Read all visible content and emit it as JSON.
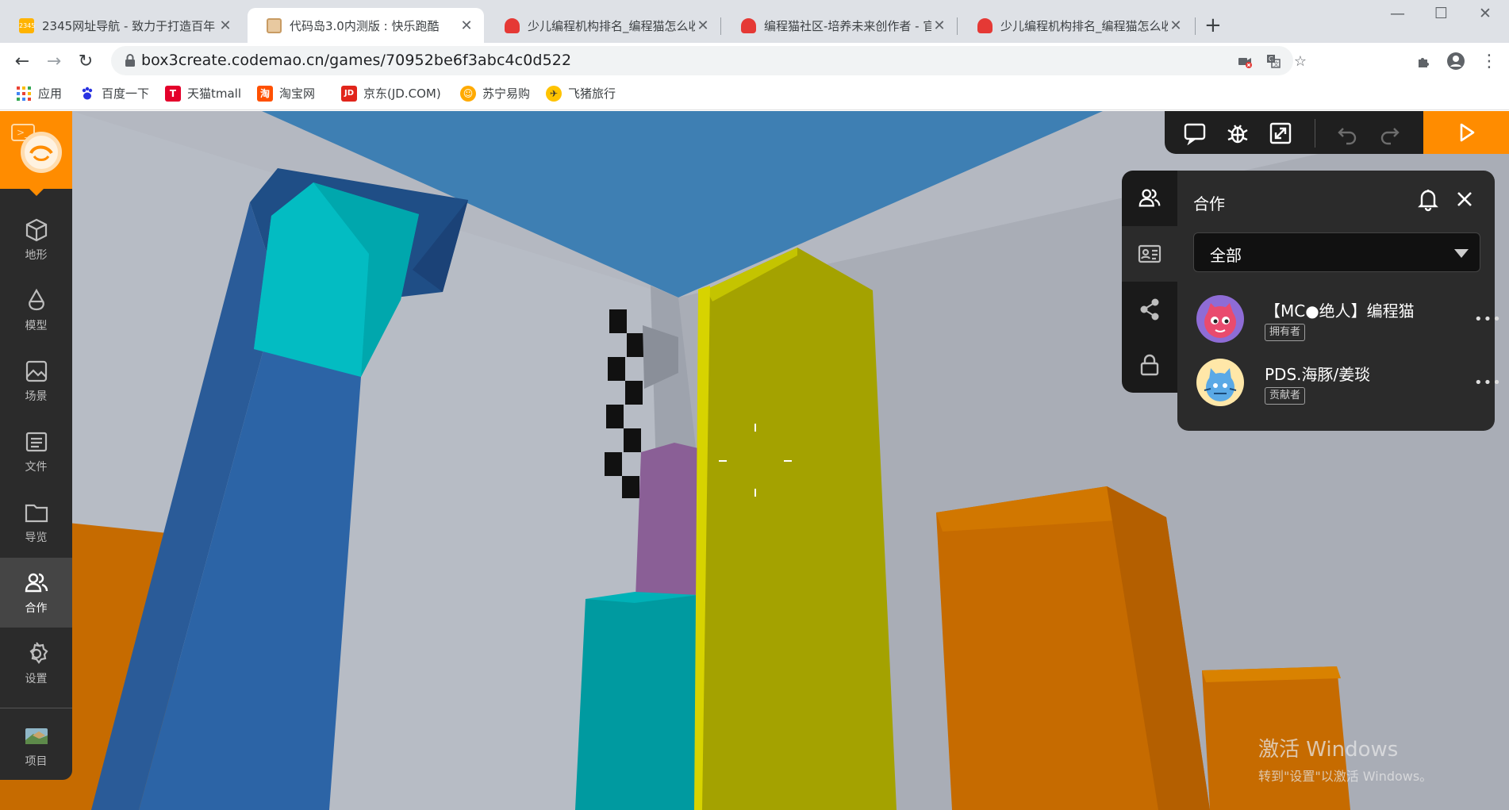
{
  "browser": {
    "tabs": [
      {
        "title": "2345网址导航 - 致力于打造百年",
        "active": false
      },
      {
        "title": "代码岛3.0内测版 : 快乐跑酷",
        "active": true
      },
      {
        "title": "少儿编程机构排名_编程猫怎么收",
        "active": false
      },
      {
        "title": "编程猫社区-培养未来创作者 - 官",
        "active": false
      },
      {
        "title": "少儿编程机构排名_编程猫怎么收",
        "active": false
      }
    ],
    "new_tab": "+",
    "window_controls": {
      "minimize": "—",
      "maximize": "☐",
      "close": "✕"
    },
    "url": "box3create.codemao.cn/games/70952be6f3abc4c0d522",
    "bookmarks": [
      {
        "label": "应用",
        "icon": "apps-grid-icon",
        "color": "#4285f4"
      },
      {
        "label": "百度一下",
        "icon": "baidu-paw-icon",
        "color": "#2932e1"
      },
      {
        "label": "天猫tmall",
        "icon": "tmall-icon",
        "color": "#e4002b",
        "glyph": "T"
      },
      {
        "label": "淘宝网",
        "icon": "taobao-icon",
        "color": "#ff5000",
        "glyph": "淘"
      },
      {
        "label": "京东(JD.COM)",
        "icon": "jd-icon",
        "color": "#e1251b",
        "glyph": "JD"
      },
      {
        "label": "苏宁易购",
        "icon": "suning-icon",
        "color": "#ffaa00",
        "glyph": "☺"
      },
      {
        "label": "飞猪旅行",
        "icon": "fliggy-icon",
        "color": "#ffc300",
        "glyph": "✈"
      }
    ]
  },
  "sidebar": {
    "items": [
      {
        "label": "地形",
        "icon": "cube-icon",
        "active": false
      },
      {
        "label": "模型",
        "icon": "model-bell-icon",
        "active": false
      },
      {
        "label": "场景",
        "icon": "image-icon",
        "active": false
      },
      {
        "label": "文件",
        "icon": "file-list-icon",
        "active": false
      },
      {
        "label": "导览",
        "icon": "folder-icon",
        "active": false
      },
      {
        "label": "合作",
        "icon": "users-icon",
        "active": true
      },
      {
        "label": "设置",
        "icon": "gear-icon",
        "active": false
      }
    ],
    "project": {
      "label": "项目",
      "icon": "project-thumbnail-icon"
    }
  },
  "game_toolbar": {
    "buttons": [
      "chat-icon",
      "debug-bug-icon",
      "fullscreen-icon",
      "undo-icon",
      "redo-icon"
    ],
    "run": "play-icon"
  },
  "collab": {
    "title": "合作",
    "filter": "全部",
    "members": [
      {
        "name": "【MC●绝人】编程猫",
        "role": "拥有者",
        "avatar": "pink-cat-avatar"
      },
      {
        "name": "PDS.海豚/姜琰",
        "role": "贡献者",
        "avatar": "blue-cat-avatar"
      }
    ]
  },
  "watermark": {
    "title": "激活 Windows",
    "subtitle": "转到\"设置\"以激活 Windows。"
  },
  "colors": {
    "accent": "#ff8c00",
    "panel": "#2b2b2b",
    "sky": "#3e7fb3",
    "wall": "#aeb3bd"
  }
}
